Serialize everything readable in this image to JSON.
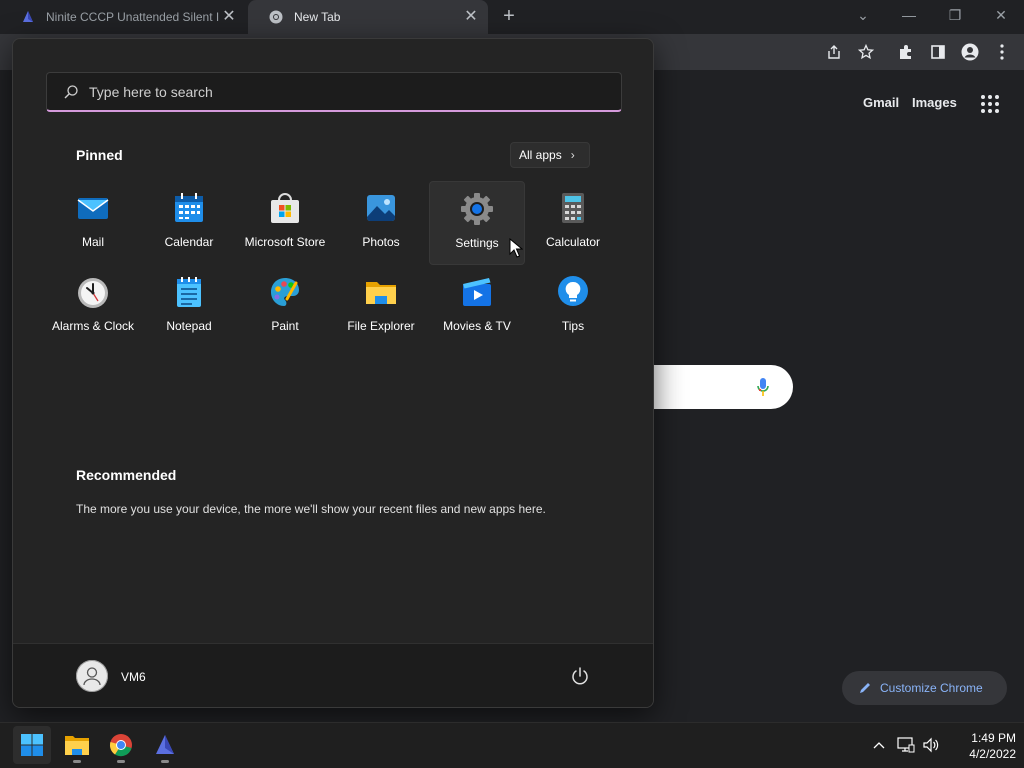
{
  "browser": {
    "tabs": [
      {
        "title": "Ninite CCCP Unattended Silent In",
        "active": false,
        "icon": "ninite-icon"
      },
      {
        "title": "New Tab",
        "active": true,
        "icon": "chrome-icon"
      }
    ],
    "new_tab_symbol": "+",
    "window_controls": {
      "tab_search": "⌄",
      "minimize": "—",
      "restore": "❐",
      "close": "✕"
    },
    "toolbar_icons": [
      "share-icon",
      "star-icon",
      "extensions-icon",
      "sidebar-icon",
      "profile-icon",
      "menu-icon"
    ]
  },
  "ntp": {
    "gmail": "Gmail",
    "images": "Images",
    "customize": "Customize Chrome"
  },
  "start_menu": {
    "search_placeholder": "Type here to search",
    "pinned_title": "Pinned",
    "all_apps": "All apps",
    "pinned": [
      {
        "label": "Mail",
        "icon": "mail-icon"
      },
      {
        "label": "Calendar",
        "icon": "calendar-icon"
      },
      {
        "label": "Microsoft Store",
        "icon": "store-icon"
      },
      {
        "label": "Photos",
        "icon": "photos-icon"
      },
      {
        "label": "Settings",
        "icon": "settings-icon",
        "hover": true
      },
      {
        "label": "Calculator",
        "icon": "calculator-icon"
      },
      {
        "label": "Alarms & Clock",
        "icon": "clock-icon"
      },
      {
        "label": "Notepad",
        "icon": "notepad-icon"
      },
      {
        "label": "Paint",
        "icon": "paint-icon"
      },
      {
        "label": "File Explorer",
        "icon": "folder-icon"
      },
      {
        "label": "Movies & TV",
        "icon": "movies-icon"
      },
      {
        "label": "Tips",
        "icon": "tips-icon"
      }
    ],
    "recommended_title": "Recommended",
    "recommended_text": "The more you use your device, the more we'll show your recent files and new apps here.",
    "user": "VM6"
  },
  "taskbar": {
    "apps": [
      "start-icon",
      "file-explorer-icon",
      "chrome-icon",
      "ninite-icon"
    ],
    "time": "1:49 PM",
    "date": "4/2/2022"
  },
  "colors": {
    "start_bg": "#242424",
    "search_accent": "#d59adb",
    "link_blue": "#8ab4f8",
    "chrome_dark": "#202124"
  }
}
